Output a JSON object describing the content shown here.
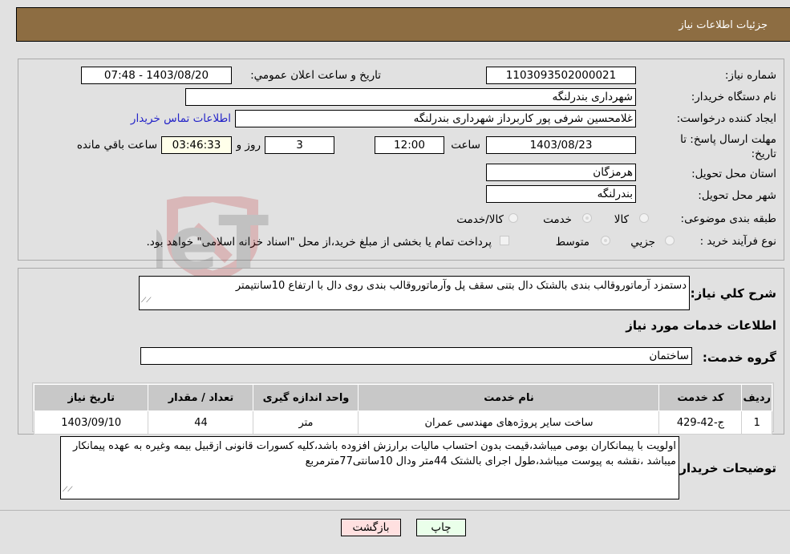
{
  "header": {
    "title": "جزئیات اطلاعات نیاز"
  },
  "form": {
    "need_number": {
      "label": "شماره نیاز:",
      "value": "1103093502000021"
    },
    "announce_datetime": {
      "label": "تاریخ و ساعت اعلان عمومي:",
      "value": "1403/08/20 - 07:48"
    },
    "buyer_org": {
      "label": "نام دستگاه خریدار:",
      "value": "شهرداری بندرلنگه"
    },
    "requester": {
      "label": "ایجاد کننده درخواست:",
      "value": "غلامحسین شرفی پور کاربرداز شهرداری بندرلنگه"
    },
    "buyer_contact_link": "اطلاعات تماس خریدار",
    "deadline": {
      "label": "مهلت ارسال پاسخ: تا تاریخ:",
      "date": "1403/08/23",
      "time_label": "ساعت",
      "time": "12:00",
      "days": "3",
      "days_label": "روز و",
      "remaining": "03:46:33",
      "remaining_label": "ساعت باقي مانده"
    },
    "province": {
      "label": "استان محل تحویل:",
      "value": "هرمزگان"
    },
    "city": {
      "label": "شهر محل تحویل:",
      "value": "بندرلنگه"
    },
    "category": {
      "label": "طبقه بندی موضوعی:",
      "options": [
        "کالا",
        "خدمت",
        "کالا/خدمت"
      ],
      "selected": "خدمت"
    },
    "process_type": {
      "label": "نوع فرآیند خرید :",
      "options": [
        "جزيي",
        "متوسط"
      ],
      "selected": "متوسط",
      "treasury_note": "پرداخت تمام یا بخشی از مبلغ خرید،از محل \"اسناد خزانه اسلامی\" خواهد بود."
    }
  },
  "description": {
    "label": "شرح کلي نیاز:",
    "value": "دستمزد آرماتوروقالب بندی بالشتک دال بتنی سقف پل وآرماتوروقالب بندی  روی دال با ارتفاع 10سانتیمتر"
  },
  "services": {
    "section_title": "اطلاعات خدمات مورد نیاز",
    "group_label": "گروه خدمت:",
    "group_value": "ساختمان",
    "table": {
      "headers": [
        "ردیف",
        "کد خدمت",
        "نام خدمت",
        "واحد اندازه گیری",
        "تعداد / مقدار",
        "تاریخ نیاز"
      ],
      "rows": [
        [
          "1",
          "ج-42-429",
          "ساخت سایر پروژه‌های مهندسی عمران",
          "متر",
          "44",
          "1403/09/10"
        ]
      ]
    }
  },
  "buyer_notes": {
    "label": "توضیحات خریدار:",
    "value": "اولویت با پیمانکاران بومی میباشد،قیمت بدون احتساب مالیات برارزش افزوده باشد،کلیه کسورات قانونی ازقبیل بیمه وغیره به عهده پیمانکار میباشد ،نقشه به پیوست میباشد،طول اجرای بالشتک 44متر ودال 10سانتی77مترمربع"
  },
  "buttons": {
    "print": "چاپ",
    "back": "بازگشت"
  },
  "watermark": {
    "text": "AriaTender.neT"
  },
  "colors": {
    "header_bg": "#8d6d42",
    "print_bg": "#eaffea",
    "back_bg": "#ffe0e0",
    "remaining_bg": "#ffffea",
    "link": "#2323c8"
  }
}
